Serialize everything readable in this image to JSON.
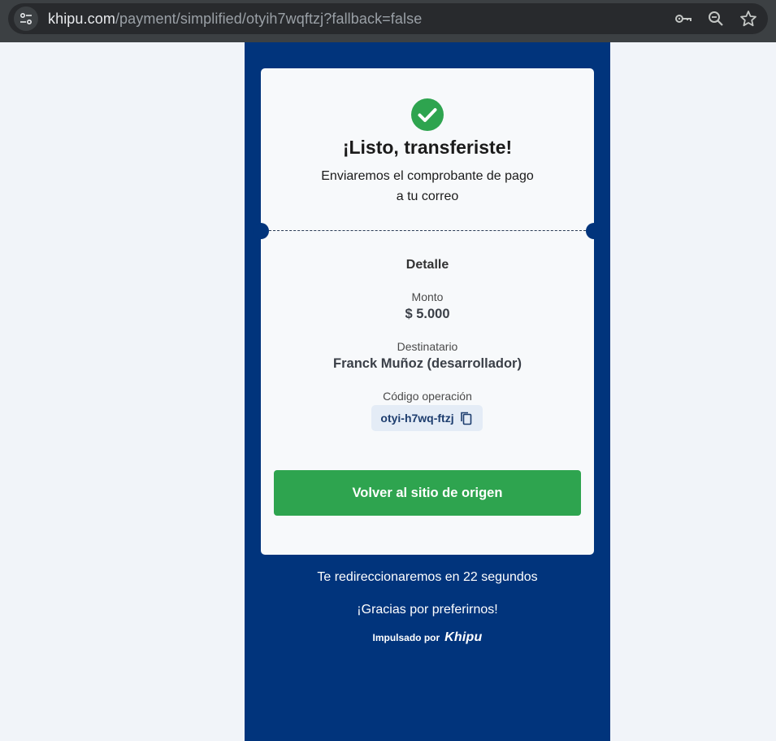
{
  "browser": {
    "url_host": "khipu.com",
    "url_path": "/payment/simplified/otyih7wqftzj?fallback=false",
    "icons": [
      "tune-icon",
      "key-icon",
      "zoom-icon",
      "star-icon"
    ]
  },
  "colors": {
    "panel_bg": "#01347c",
    "success_green": "#2ea44f",
    "card_bg": "#f7f9fb"
  },
  "receipt": {
    "title": "¡Listo, transferiste!",
    "subtitle_line1": "Enviaremos el comprobante de pago",
    "subtitle_line2": "a tu correo",
    "detail_heading": "Detalle",
    "amount_label": "Monto",
    "amount_value": "$ 5.000",
    "recipient_label": "Destinatario",
    "recipient_value": "Franck Muñoz (desarrollador)",
    "operation_label": "Código operación",
    "operation_code": "otyi-h7wq-ftzj",
    "return_button": "Volver al sitio de origen"
  },
  "footer": {
    "redirect_text": "Te redireccionaremos en 22 segundos",
    "thanks_text": "¡Gracias por preferirnos!",
    "powered_by": "Impulsado por",
    "brand": "Khipu"
  }
}
